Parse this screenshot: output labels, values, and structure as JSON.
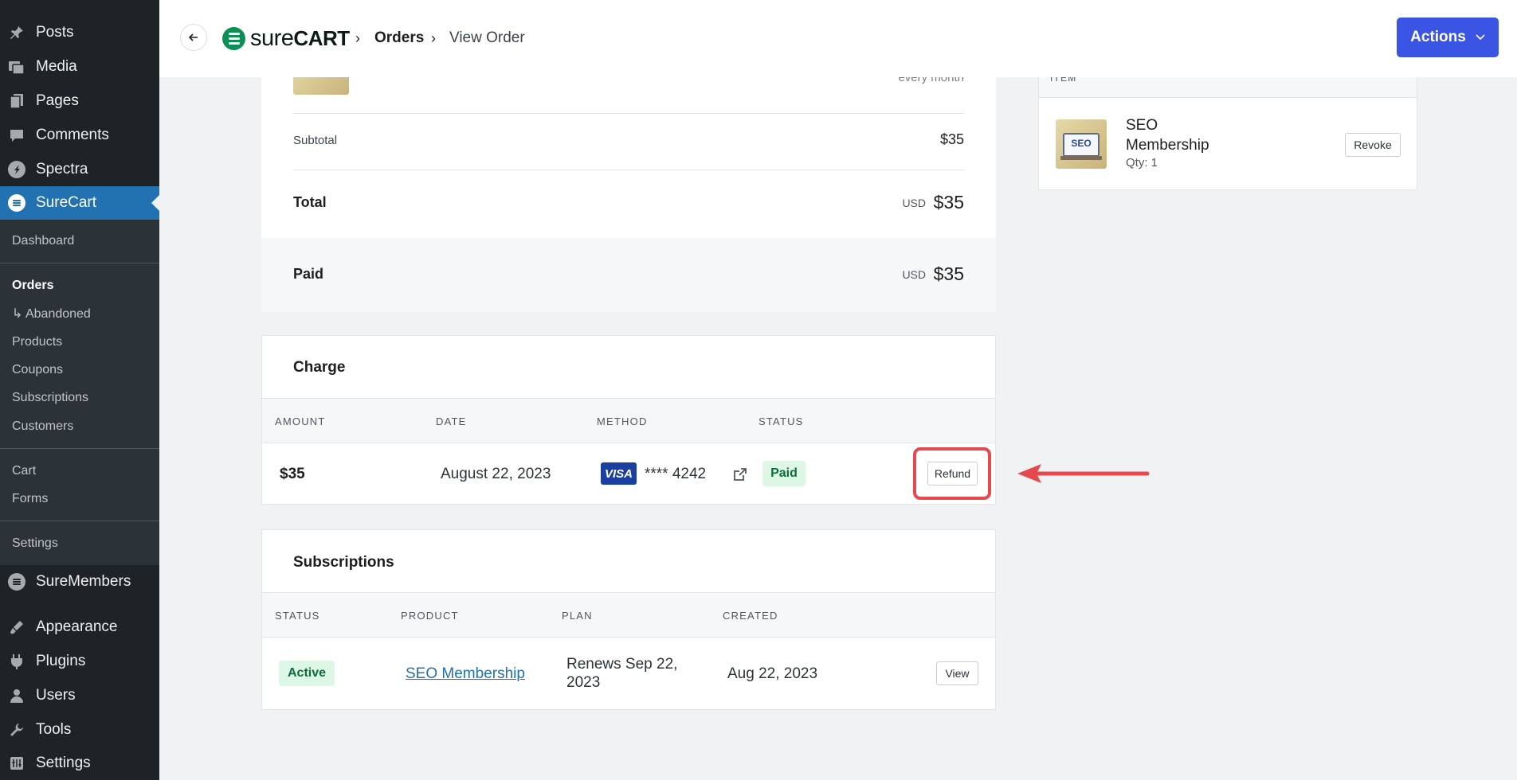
{
  "sidebar": {
    "top_items": [
      {
        "label": "Posts",
        "icon": "pin-icon"
      },
      {
        "label": "Media",
        "icon": "media-icon"
      },
      {
        "label": "Pages",
        "icon": "pages-icon"
      },
      {
        "label": "Comments",
        "icon": "comment-icon"
      },
      {
        "label": "Spectra",
        "icon": "spectra-icon"
      },
      {
        "label": "SureCart",
        "icon": "surecart-icon"
      }
    ],
    "sub_items": [
      "Dashboard",
      "Orders",
      "↳ Abandoned",
      "Products",
      "Coupons",
      "Subscriptions",
      "Customers",
      "Cart",
      "Forms",
      "Settings"
    ],
    "bottom_items": [
      {
        "label": "SureMembers",
        "icon": "suremembers-icon"
      },
      {
        "label": "Appearance",
        "icon": "appearance-icon"
      },
      {
        "label": "Plugins",
        "icon": "plugin-icon"
      },
      {
        "label": "Users",
        "icon": "user-icon"
      },
      {
        "label": "Tools",
        "icon": "wrench-icon"
      },
      {
        "label": "Settings",
        "icon": "settings-icon"
      }
    ]
  },
  "header": {
    "logo_light": "sure",
    "logo_bold": "CART",
    "breadcrumb": [
      "Orders",
      "View Order"
    ],
    "actions_label": "Actions"
  },
  "summary": {
    "interval": "every month",
    "subtotal_label": "Subtotal",
    "subtotal_value": "$35",
    "total_label": "Total",
    "total_currency": "USD",
    "total_value": "$35",
    "paid_label": "Paid",
    "paid_currency": "USD",
    "paid_value": "$35"
  },
  "charge": {
    "title": "Charge",
    "headers": [
      "AMOUNT",
      "DATE",
      "METHOD",
      "STATUS"
    ],
    "amount": "$35",
    "date": "August 22, 2023",
    "card_brand": "VISA",
    "card_last4": "**** 4242",
    "status": "Paid",
    "refund_label": "Refund"
  },
  "subscriptions": {
    "title": "Subscriptions",
    "headers": [
      "STATUS",
      "PRODUCT",
      "PLAN",
      "CREATED"
    ],
    "status": "Active",
    "product": "SEO Membership",
    "plan_line1": "Renews Sep 22,",
    "plan_line2": "2023",
    "created": "Aug 22, 2023",
    "view_label": "View"
  },
  "purchases": {
    "header": "ITEM",
    "item_name_line1": "SEO",
    "item_name_line2": "Membership",
    "qty": "Qty: 1",
    "revoke_label": "Revoke"
  },
  "colors": {
    "sidebar_bg": "#1d2327",
    "active_blue": "#2271b1",
    "actions_blue": "#3a54e3",
    "highlight_red": "#e5484d",
    "paid_green_bg": "#dcf7e6"
  }
}
